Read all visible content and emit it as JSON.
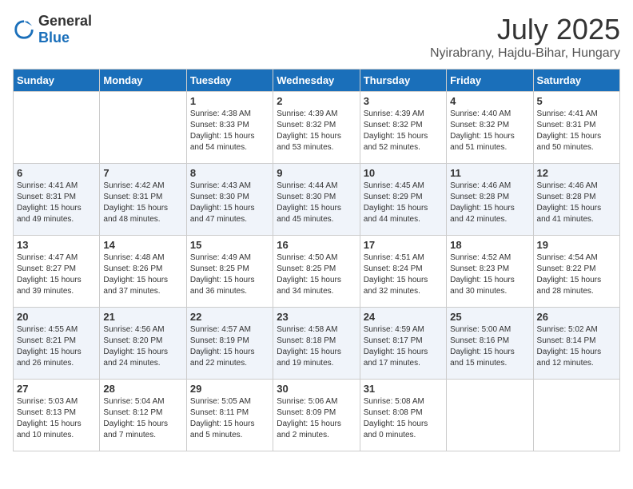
{
  "header": {
    "logo_general": "General",
    "logo_blue": "Blue",
    "month_year": "July 2025",
    "location": "Nyirabrany, Hajdu-Bihar, Hungary"
  },
  "days_of_week": [
    "Sunday",
    "Monday",
    "Tuesday",
    "Wednesday",
    "Thursday",
    "Friday",
    "Saturday"
  ],
  "weeks": [
    [
      {
        "day": "",
        "sunrise": "",
        "sunset": "",
        "daylight": ""
      },
      {
        "day": "",
        "sunrise": "",
        "sunset": "",
        "daylight": ""
      },
      {
        "day": "1",
        "sunrise": "Sunrise: 4:38 AM",
        "sunset": "Sunset: 8:33 PM",
        "daylight": "Daylight: 15 hours and 54 minutes."
      },
      {
        "day": "2",
        "sunrise": "Sunrise: 4:39 AM",
        "sunset": "Sunset: 8:32 PM",
        "daylight": "Daylight: 15 hours and 53 minutes."
      },
      {
        "day": "3",
        "sunrise": "Sunrise: 4:39 AM",
        "sunset": "Sunset: 8:32 PM",
        "daylight": "Daylight: 15 hours and 52 minutes."
      },
      {
        "day": "4",
        "sunrise": "Sunrise: 4:40 AM",
        "sunset": "Sunset: 8:32 PM",
        "daylight": "Daylight: 15 hours and 51 minutes."
      },
      {
        "day": "5",
        "sunrise": "Sunrise: 4:41 AM",
        "sunset": "Sunset: 8:31 PM",
        "daylight": "Daylight: 15 hours and 50 minutes."
      }
    ],
    [
      {
        "day": "6",
        "sunrise": "Sunrise: 4:41 AM",
        "sunset": "Sunset: 8:31 PM",
        "daylight": "Daylight: 15 hours and 49 minutes."
      },
      {
        "day": "7",
        "sunrise": "Sunrise: 4:42 AM",
        "sunset": "Sunset: 8:31 PM",
        "daylight": "Daylight: 15 hours and 48 minutes."
      },
      {
        "day": "8",
        "sunrise": "Sunrise: 4:43 AM",
        "sunset": "Sunset: 8:30 PM",
        "daylight": "Daylight: 15 hours and 47 minutes."
      },
      {
        "day": "9",
        "sunrise": "Sunrise: 4:44 AM",
        "sunset": "Sunset: 8:30 PM",
        "daylight": "Daylight: 15 hours and 45 minutes."
      },
      {
        "day": "10",
        "sunrise": "Sunrise: 4:45 AM",
        "sunset": "Sunset: 8:29 PM",
        "daylight": "Daylight: 15 hours and 44 minutes."
      },
      {
        "day": "11",
        "sunrise": "Sunrise: 4:46 AM",
        "sunset": "Sunset: 8:28 PM",
        "daylight": "Daylight: 15 hours and 42 minutes."
      },
      {
        "day": "12",
        "sunrise": "Sunrise: 4:46 AM",
        "sunset": "Sunset: 8:28 PM",
        "daylight": "Daylight: 15 hours and 41 minutes."
      }
    ],
    [
      {
        "day": "13",
        "sunrise": "Sunrise: 4:47 AM",
        "sunset": "Sunset: 8:27 PM",
        "daylight": "Daylight: 15 hours and 39 minutes."
      },
      {
        "day": "14",
        "sunrise": "Sunrise: 4:48 AM",
        "sunset": "Sunset: 8:26 PM",
        "daylight": "Daylight: 15 hours and 37 minutes."
      },
      {
        "day": "15",
        "sunrise": "Sunrise: 4:49 AM",
        "sunset": "Sunset: 8:25 PM",
        "daylight": "Daylight: 15 hours and 36 minutes."
      },
      {
        "day": "16",
        "sunrise": "Sunrise: 4:50 AM",
        "sunset": "Sunset: 8:25 PM",
        "daylight": "Daylight: 15 hours and 34 minutes."
      },
      {
        "day": "17",
        "sunrise": "Sunrise: 4:51 AM",
        "sunset": "Sunset: 8:24 PM",
        "daylight": "Daylight: 15 hours and 32 minutes."
      },
      {
        "day": "18",
        "sunrise": "Sunrise: 4:52 AM",
        "sunset": "Sunset: 8:23 PM",
        "daylight": "Daylight: 15 hours and 30 minutes."
      },
      {
        "day": "19",
        "sunrise": "Sunrise: 4:54 AM",
        "sunset": "Sunset: 8:22 PM",
        "daylight": "Daylight: 15 hours and 28 minutes."
      }
    ],
    [
      {
        "day": "20",
        "sunrise": "Sunrise: 4:55 AM",
        "sunset": "Sunset: 8:21 PM",
        "daylight": "Daylight: 15 hours and 26 minutes."
      },
      {
        "day": "21",
        "sunrise": "Sunrise: 4:56 AM",
        "sunset": "Sunset: 8:20 PM",
        "daylight": "Daylight: 15 hours and 24 minutes."
      },
      {
        "day": "22",
        "sunrise": "Sunrise: 4:57 AM",
        "sunset": "Sunset: 8:19 PM",
        "daylight": "Daylight: 15 hours and 22 minutes."
      },
      {
        "day": "23",
        "sunrise": "Sunrise: 4:58 AM",
        "sunset": "Sunset: 8:18 PM",
        "daylight": "Daylight: 15 hours and 19 minutes."
      },
      {
        "day": "24",
        "sunrise": "Sunrise: 4:59 AM",
        "sunset": "Sunset: 8:17 PM",
        "daylight": "Daylight: 15 hours and 17 minutes."
      },
      {
        "day": "25",
        "sunrise": "Sunrise: 5:00 AM",
        "sunset": "Sunset: 8:16 PM",
        "daylight": "Daylight: 15 hours and 15 minutes."
      },
      {
        "day": "26",
        "sunrise": "Sunrise: 5:02 AM",
        "sunset": "Sunset: 8:14 PM",
        "daylight": "Daylight: 15 hours and 12 minutes."
      }
    ],
    [
      {
        "day": "27",
        "sunrise": "Sunrise: 5:03 AM",
        "sunset": "Sunset: 8:13 PM",
        "daylight": "Daylight: 15 hours and 10 minutes."
      },
      {
        "day": "28",
        "sunrise": "Sunrise: 5:04 AM",
        "sunset": "Sunset: 8:12 PM",
        "daylight": "Daylight: 15 hours and 7 minutes."
      },
      {
        "day": "29",
        "sunrise": "Sunrise: 5:05 AM",
        "sunset": "Sunset: 8:11 PM",
        "daylight": "Daylight: 15 hours and 5 minutes."
      },
      {
        "day": "30",
        "sunrise": "Sunrise: 5:06 AM",
        "sunset": "Sunset: 8:09 PM",
        "daylight": "Daylight: 15 hours and 2 minutes."
      },
      {
        "day": "31",
        "sunrise": "Sunrise: 5:08 AM",
        "sunset": "Sunset: 8:08 PM",
        "daylight": "Daylight: 15 hours and 0 minutes."
      },
      {
        "day": "",
        "sunrise": "",
        "sunset": "",
        "daylight": ""
      },
      {
        "day": "",
        "sunrise": "",
        "sunset": "",
        "daylight": ""
      }
    ]
  ]
}
